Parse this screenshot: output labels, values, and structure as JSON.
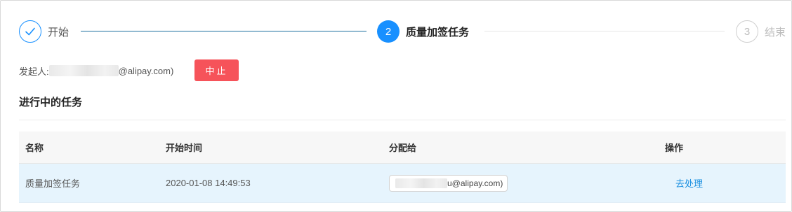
{
  "colors": {
    "primary": "#1890ff",
    "danger": "#f6535a",
    "row_highlight": "#e6f4fd",
    "link": "#1a8fe0"
  },
  "steps": [
    {
      "label": "开始",
      "status": "finished",
      "icon": "check-icon"
    },
    {
      "number": "2",
      "label": "质量加签任务",
      "status": "process"
    },
    {
      "number": "3",
      "label": "结束",
      "status": "wait"
    }
  ],
  "initiator": {
    "label": "发起人:",
    "email_suffix": "@alipay.com)"
  },
  "stop_button": {
    "label": "中止"
  },
  "section": {
    "title": "进行中的任务"
  },
  "table": {
    "columns": [
      "名称",
      "开始时间",
      "分配给",
      "操作"
    ],
    "rows": [
      {
        "name": "质量加签任务",
        "start_time": "2020-01-08 14:49:53",
        "assignee_suffix": "u@alipay.com)",
        "action": "去处理"
      }
    ]
  }
}
